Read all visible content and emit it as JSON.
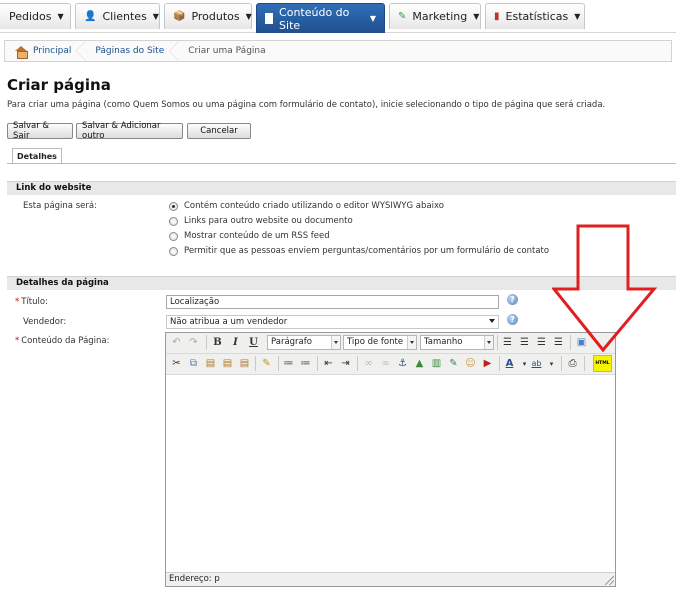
{
  "nav": {
    "tabs": [
      {
        "label": "Pedidos",
        "icon": "orders-icon"
      },
      {
        "label": "Clientes",
        "icon": "customers-icon"
      },
      {
        "label": "Produtos",
        "icon": "products-icon"
      },
      {
        "label": "Conteúdo do Site",
        "icon": "content-icon",
        "active": true
      },
      {
        "label": "Marketing",
        "icon": "marketing-icon"
      },
      {
        "label": "Estatísticas",
        "icon": "statistics-icon"
      }
    ]
  },
  "breadcrumb": [
    "Principal",
    "Páginas do Site",
    "Criar uma Página"
  ],
  "page": {
    "title": "Criar página",
    "intro": "Para criar uma página (como Quem Somos ou uma página com formulário de contato), inicie selecionando o tipo de página que será criada."
  },
  "actions": {
    "save_exit": "Salvar & Sair",
    "save_add": "Salvar & Adicionar outro",
    "cancel": "Cancelar"
  },
  "tabs": {
    "details": "Detalhes"
  },
  "link_section": {
    "header": "Link do website",
    "label": "Esta página será:",
    "options": [
      "Contém conteúdo criado utilizando o editor WYSIWYG abaixo",
      "Links para outro website ou documento",
      "Mostrar conteúdo de um RSS feed",
      "Permitir que as pessoas enviem perguntas/comentários por um formulário de contato"
    ],
    "selected_index": 0
  },
  "details_section": {
    "header": "Detalhes da página",
    "title_label": "Título:",
    "title_value": "Localização",
    "vendor_label": "Vendedor:",
    "vendor_value": "Não atribua a um vendedor",
    "content_label": "Conteúdo da Página:"
  },
  "editor": {
    "format_select": "Parágrafo",
    "font_select": "Tipo de fonte",
    "size_select": "Tamanho",
    "bold": "B",
    "italic": "I",
    "underline": "U",
    "html_button": "HTML",
    "status": "Endereço: p"
  },
  "colors": {
    "accent": "#2a5fa5",
    "highlight": "#f5f500",
    "arrow": "#e02020"
  }
}
